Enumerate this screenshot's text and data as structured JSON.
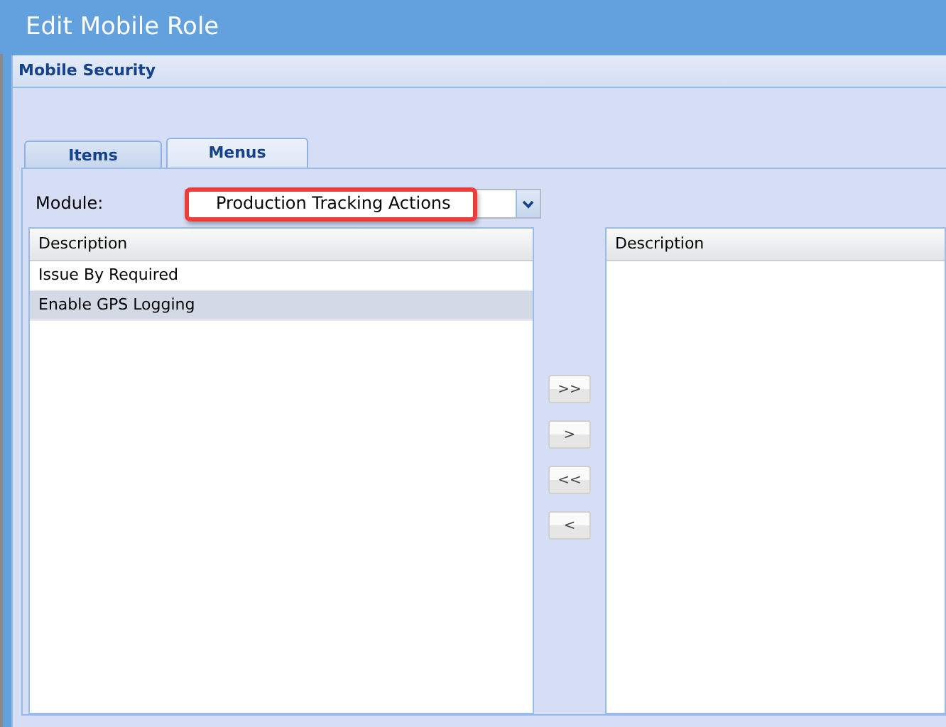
{
  "window": {
    "title": "Edit Mobile Role"
  },
  "panel": {
    "title": "Mobile Security"
  },
  "tabs": [
    {
      "label": "Items",
      "selected": false
    },
    {
      "label": "Menus",
      "selected": true
    }
  ],
  "module": {
    "label": "Module:",
    "value": "Production Tracking Actions",
    "highlighted": true
  },
  "available_list": {
    "column": "Description",
    "rows": [
      {
        "text": "Issue By Required",
        "selected": false
      },
      {
        "text": "Enable GPS Logging",
        "selected": true
      }
    ]
  },
  "move_buttons": [
    ">>",
    ">",
    "<<",
    "<"
  ],
  "assigned_list": {
    "column": "Description"
  }
}
